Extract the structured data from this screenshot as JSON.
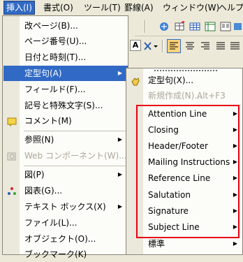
{
  "menubar": {
    "items": [
      {
        "label": "挿入(I)",
        "active": true
      },
      {
        "label": "書式(O)"
      },
      {
        "label": "ツール(T)"
      },
      {
        "label": "罫線(A)"
      },
      {
        "label": "ウィンドウ(W)"
      },
      {
        "label": "ヘルプ("
      }
    ]
  },
  "toolbar": {
    "font_button": "A"
  },
  "insert_menu": {
    "items": [
      {
        "label": "改ページ(B)..."
      },
      {
        "label": "ページ番号(U)..."
      },
      {
        "label": "日付と時刻(T)..."
      },
      {
        "label": "定型句(A)"
      },
      {
        "label": "フィールド(F)..."
      },
      {
        "label": "記号と特殊文字(S)..."
      },
      {
        "label": "コメント(M)"
      },
      {
        "label": "参照(N)"
      },
      {
        "label": "Web コンポーネント(W)..."
      },
      {
        "label": "図(P)"
      },
      {
        "label": "図表(G)..."
      },
      {
        "label": "テキスト ボックス(X)"
      },
      {
        "label": "ファイル(L)..."
      },
      {
        "label": "オブジェクト(O)..."
      },
      {
        "label": "ブックマーク(K)"
      }
    ]
  },
  "autotext_menu": {
    "items": [
      {
        "label": "定型句(X)..."
      },
      {
        "label": "新規作成(N)...",
        "shortcut": "Alt+F3"
      },
      {
        "label": "Attention Line"
      },
      {
        "label": "Closing"
      },
      {
        "label": "Header/Footer"
      },
      {
        "label": "Mailing Instructions"
      },
      {
        "label": "Reference Line"
      },
      {
        "label": "Salutation"
      },
      {
        "label": "Signature"
      },
      {
        "label": "Subject Line"
      },
      {
        "label": "標準"
      }
    ]
  },
  "colors": {
    "highlight": "#316ac5",
    "annotation_box": "#e60012",
    "disabled_text": "#aca899"
  }
}
